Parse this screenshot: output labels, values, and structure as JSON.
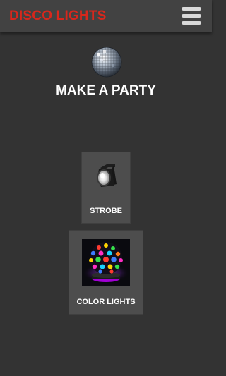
{
  "app_bar": {
    "title": "DISCO LIGHTS",
    "title_color": "#d8271c",
    "menu_icon": "hamburger-menu-icon"
  },
  "hero": {
    "icon": "disco-ball-icon",
    "title": "MAKE A PARTY"
  },
  "modes": [
    {
      "label": "STROBE",
      "icon": "strobe-light-icon"
    },
    {
      "label": "COLOR LIGHTS",
      "icon": "color-disco-ball-icon"
    }
  ]
}
